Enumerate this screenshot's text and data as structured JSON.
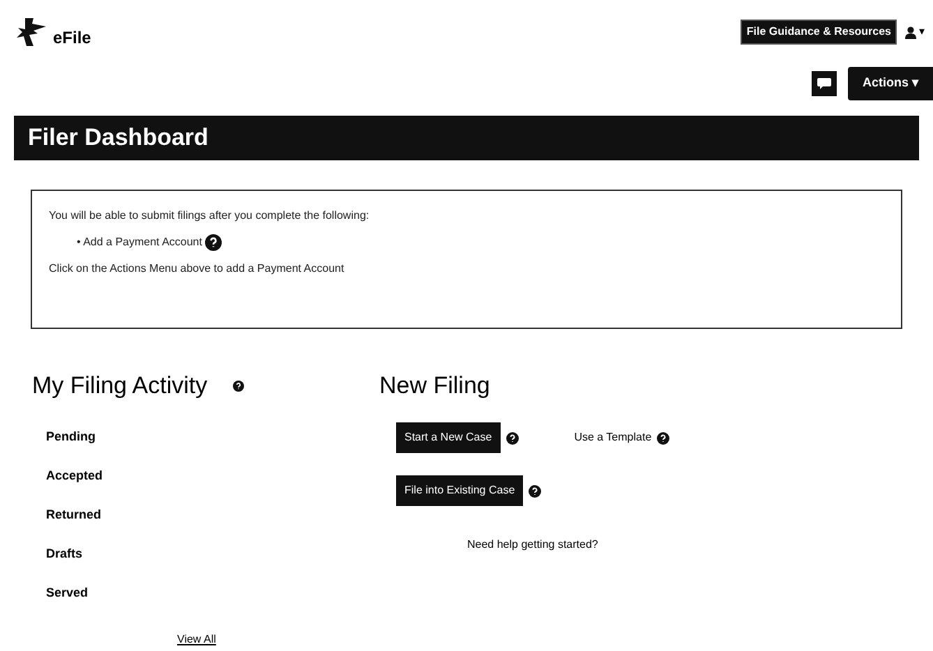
{
  "header": {
    "logo_text": "eFile",
    "badge": "File Guidance & Resources",
    "user_menu_caret": "▾"
  },
  "toolbar": {
    "actions_button": "Actions ▾"
  },
  "title": "Filer Dashboard",
  "notice": {
    "intro": "You will be able to submit filings after you complete the following:",
    "items": [
      "• Add a Payment Account"
    ],
    "footer": "Click on the Actions Menu above to add a Payment Account"
  },
  "activity": {
    "heading": "My Filing Activity",
    "items": [
      "Pending",
      "Accepted",
      "Returned",
      "Drafts",
      "Served"
    ],
    "view_all": "View All"
  },
  "new_filing": {
    "heading": "New Filing",
    "start_button": "Start a New Case",
    "template_link": "Use a Template",
    "existing_button": "File into Existing Case",
    "help_link": "Need help getting started?"
  }
}
